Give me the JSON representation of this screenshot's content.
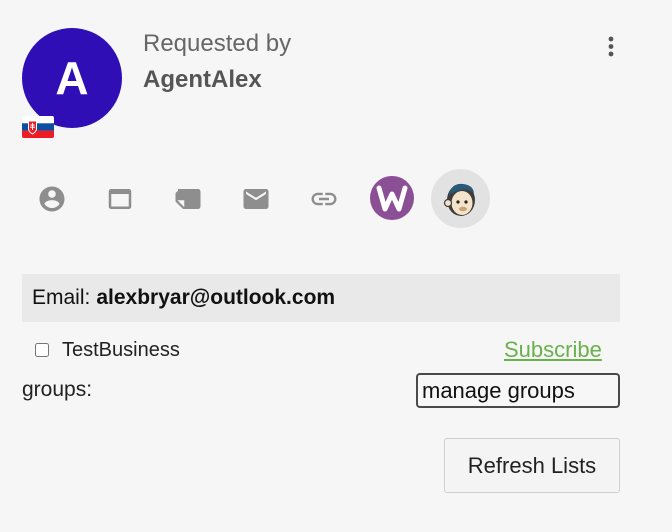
{
  "requester": {
    "avatar_initial": "A",
    "avatar_color": "#2f0fb5",
    "label": "Requested by",
    "name": "AgentAlex",
    "flag_icon": "slovakia-flag-icon"
  },
  "menu": {
    "icon": "more-vertical-icon"
  },
  "actions": [
    {
      "icon": "user-profile-icon"
    },
    {
      "icon": "browser-window-icon"
    },
    {
      "icon": "note-icon"
    },
    {
      "icon": "mail-icon"
    },
    {
      "icon": "link-icon"
    },
    {
      "icon": "woocommerce-icon",
      "color": "#8a4f94"
    },
    {
      "icon": "mailchimp-icon"
    }
  ],
  "email": {
    "label": "Email:",
    "value": "alexbryar@outlook.com"
  },
  "lists": [
    {
      "name": "TestBusiness",
      "action": "Subscribe",
      "checked": false
    }
  ],
  "groups": {
    "label": "groups:",
    "manage_label": "manage groups"
  },
  "refresh_label": "Refresh Lists",
  "colors": {
    "subscribe_link": "#6ab04c",
    "icon_gray": "#8e8e8e",
    "email_bar_bg": "#e9e9e9"
  }
}
